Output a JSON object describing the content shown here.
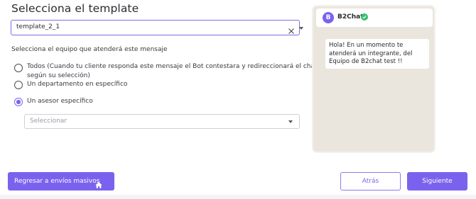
{
  "page": {
    "title": "Selecciona el template"
  },
  "template_select": {
    "value": "template_2_1"
  },
  "team": {
    "question": "Selecciona el equipo que atenderá este mensaje",
    "options": [
      {
        "line1": "Todos (Cuando tu cliente responda este mensaje el Bot contestara y redireccionará el chat",
        "line2": "según su selección)",
        "selected": false
      },
      {
        "line1": "Un departamento en específico",
        "selected": false
      },
      {
        "line1": "Un asesor específico",
        "selected": true
      }
    ],
    "asesor_placeholder": "Seleccionar"
  },
  "preview": {
    "sender": "B2Chat",
    "avatar_letter": "B",
    "message_lines": [
      "Hola! En un momento te",
      "atenderá un integrante, del",
      "Equipo de B2chat test !!"
    ]
  },
  "buttons": {
    "back_mass": "Regresar a envíos masivos",
    "back": "Atrás",
    "next": "Siguiente"
  },
  "colors": {
    "accent": "#7b62ee",
    "verified": "#36c06a",
    "chat_bg": "#ebe6dd"
  }
}
